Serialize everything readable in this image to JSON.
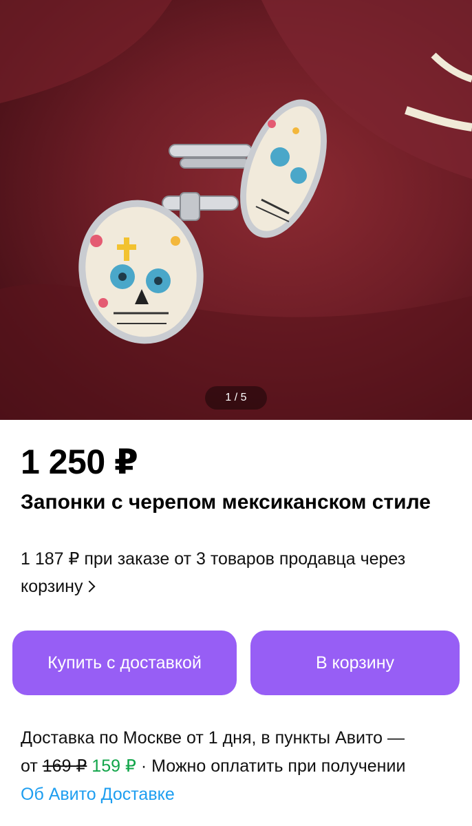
{
  "gallery": {
    "counter": "1 / 5",
    "current": 1,
    "total": 5
  },
  "product": {
    "price": "1 250 ₽",
    "title": "Запонки с черепом мексиканском стиле",
    "bulk_offer": "1 187 ₽ при заказе от 3 товаров продавца через корзину"
  },
  "actions": {
    "buy_label": "Купить с доставкой",
    "cart_label": "В корзину"
  },
  "delivery": {
    "line1": "Доставка по Москве от 1 дня, в пункты Авито —",
    "from": "от",
    "old_price": "169 ₽",
    "new_price": "159 ₽",
    "payment_note": "· Можно оплатить при получении",
    "link": "Об Авито Доставке"
  },
  "colors": {
    "accent": "#975ef5",
    "discount_price": "#12a54a",
    "link": "#1e9ef0",
    "photo_background": "#6d1d26"
  }
}
